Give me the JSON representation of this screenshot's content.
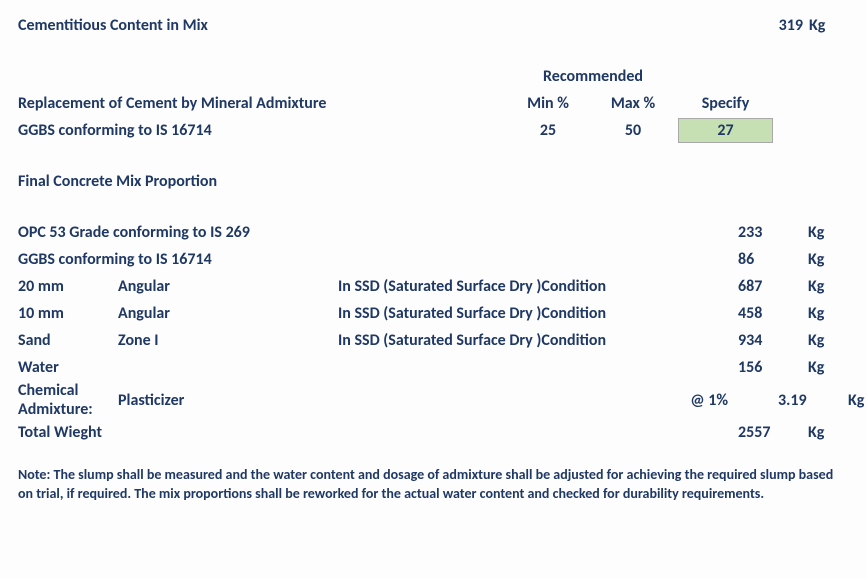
{
  "cementitious": {
    "label": "Cementitious Content in Mix",
    "value": "319",
    "unit": "Kg"
  },
  "replacement": {
    "header_recommended": "Recommended",
    "header_min": "Min %",
    "header_max": "Max %",
    "header_specify": "Specify",
    "row_label": "Replacement of Cement by Mineral Admixture",
    "item_label": "GGBS conforming to IS 16714",
    "min": "25",
    "max": "50",
    "specify": "27"
  },
  "final": {
    "title": "Final Concrete Mix Proportion",
    "rows": [
      {
        "a": "OPC 53 Grade conforming to IS 269",
        "b": "",
        "c": "",
        "val": "233",
        "unit": "Kg"
      },
      {
        "a": "GGBS conforming to IS 16714",
        "b": "",
        "c": "",
        "val": "86",
        "unit": "Kg"
      },
      {
        "a": "20 mm",
        "b": "Angular",
        "c": "In SSD (Saturated Surface Dry )Condition",
        "val": "687",
        "unit": "Kg"
      },
      {
        "a": "10 mm",
        "b": "Angular",
        "c": "In SSD (Saturated Surface Dry )Condition",
        "val": "458",
        "unit": "Kg"
      },
      {
        "a": "Sand",
        "b": "Zone I",
        "c": "In SSD (Saturated Surface Dry )Condition",
        "val": "934",
        "unit": "Kg"
      },
      {
        "a": "Water",
        "b": "",
        "c": "",
        "val": "156",
        "unit": "Kg"
      },
      {
        "a": "Chemical Admixture:",
        "b": "Plasticizer",
        "c_right": "@ 1%",
        "val": "3.19",
        "unit": "Kg"
      },
      {
        "a": "Total Wieght",
        "b": "",
        "c": "",
        "val": "2557",
        "unit": "Kg"
      }
    ]
  },
  "note": "Note: The slump shall be measured and the water content and dosage of admixture shall be adjusted for achieving the required slump based on trial, if required. The mix proportions shall be reworked for the actual water content and checked for durability requirements."
}
